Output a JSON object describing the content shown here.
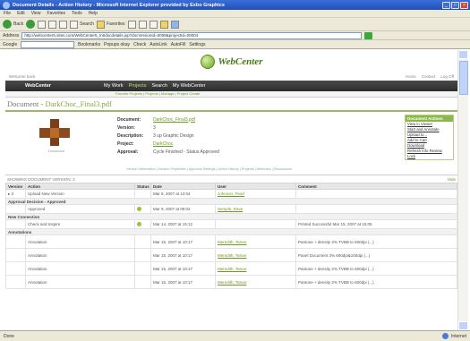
{
  "window": {
    "title": "Document Details - Action History - Microsoft Internet Explorer provided by Exbo Graphics"
  },
  "menu": [
    "File",
    "Edit",
    "View",
    "Favorites",
    "Tools",
    "Help"
  ],
  "toolbar": {
    "back": "Back",
    "search": "Search",
    "favorites": "Favorites"
  },
  "address": {
    "label": "Address",
    "url": "http://webcenter5.sites.com/WebCenter5_Int/docdetails.jsp?docVersionId=0008&projectId=00004"
  },
  "links": {
    "google": "Google",
    "bookmarks": "Bookmarks",
    "popups": "Popups okay",
    "check": "Check",
    "autolink": "AutoLink",
    "autofill": "AutoFill",
    "settings": "Settings"
  },
  "site": {
    "logo": "WebCenter",
    "util_left": "Welcome back",
    "util_links": [
      "Home",
      "Contact",
      "Log Off"
    ]
  },
  "nav": {
    "brand": "WebCenter",
    "tabs": [
      "My Work",
      "Projects",
      "Search",
      "My WebCenter"
    ],
    "subtabs": "Favorite Projects | Projects | Manage | Project Create"
  },
  "document": {
    "title_prefix": "Document - ",
    "filename": "DarkChoc_Final3.pdf",
    "caption": "Download"
  },
  "props": [
    {
      "label": "Document:",
      "value": "DarkChoc_Final3.pdf",
      "link": true
    },
    {
      "label": "Version:",
      "value": "3",
      "link": false
    },
    {
      "label": "Description:",
      "value": "3 up Graphic Design",
      "link": false
    },
    {
      "label": "Project:",
      "value": "DarkChoc",
      "link": true
    },
    {
      "label": "Approval:",
      "value": "Cycle Finished - Status Approved",
      "link": false
    }
  ],
  "actions": {
    "header": "Document Actions",
    "items": [
      "View in Viewer",
      "Start and Annotate",
      "Upload to...",
      "Add to Cart",
      "Download",
      "Refresh Info Review",
      "Lock"
    ]
  },
  "info_links": "Version Information | Version Properties | Approval Settings | Action History | Projects | Attributes | Discussions",
  "revisions": {
    "label": "SHOWING DOCUMENT VERSION: 3",
    "right": "Hide",
    "columns": [
      "Version",
      "Action",
      "Status",
      "Date",
      "User",
      "Comment"
    ],
    "rows": [
      {
        "type": "row",
        "version": "▸ 3",
        "action": "Upload New Version",
        "status": "",
        "date": "Mar 8, 2007 at 13:04",
        "user": "Johnson, Pearl",
        "comment": ""
      },
      {
        "type": "sec",
        "label": "Approval Decision - Approved"
      },
      {
        "type": "row",
        "version": "",
        "action": "Approved",
        "status": "ok",
        "date": "Mar 9, 2007 at 09:02",
        "user": "Semple, Dave",
        "comment": ""
      },
      {
        "type": "sec",
        "label": "New Connection"
      },
      {
        "type": "row",
        "version": "",
        "action": "Check and Inspire",
        "status": "ok",
        "date": "Mar 14, 2007 at 15:12",
        "user": "",
        "comment": "Printed Successful Mar 15, 2007 at 15:05"
      },
      {
        "type": "sec",
        "label": "Annotations"
      },
      {
        "type": "tall",
        "version": "",
        "action": "Annotation",
        "status": "",
        "date": "Mar 15, 2007 at 10:17",
        "user": "Meredith, Tamar",
        "comment": "Pantone + density 2% TVBB to 600dpi (...)"
      },
      {
        "type": "tall",
        "version": "",
        "action": "Annotation",
        "status": "",
        "date": "Mar 15, 2007 at 10:17",
        "user": "Meredith, Tamar",
        "comment": "Panel Document 3% 600dpi&100dpi (...)"
      },
      {
        "type": "tall",
        "version": "",
        "action": "Annotation",
        "status": "",
        "date": "Mar 15, 2007 at 10:17",
        "user": "Meredith, Tamar",
        "comment": "Pantone + density 2% TVBB to 600dpi (...)"
      },
      {
        "type": "tall",
        "version": "",
        "action": "Annotation",
        "status": "",
        "date": "Mar 15, 2007 at 10:17",
        "user": "Meredith, Tamar",
        "comment": "Pantone + density 2% TVBB to 600dpi (...)"
      }
    ]
  },
  "status": {
    "left": "Done",
    "zone": "Internet"
  },
  "colors": {
    "accent": "#6d9a20",
    "nav_bg": "#333333",
    "title_bar": "#2a5ccb"
  }
}
